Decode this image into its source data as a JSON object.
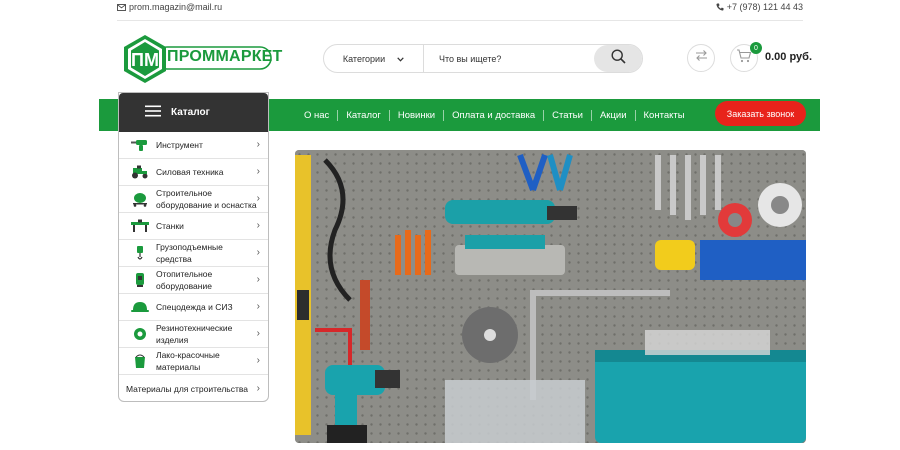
{
  "topbar": {
    "email": "prom.magazin@mail.ru",
    "phone": "+7 (978) 121 44 43"
  },
  "logo": {
    "mark": "ПМ",
    "text": "ПРОММАРКЕТ"
  },
  "search": {
    "category_label": "Категории",
    "placeholder": "Что вы ищете?"
  },
  "cart": {
    "count": "0",
    "total": "0.00 руб."
  },
  "nav": {
    "items": [
      "О нас",
      "Каталог",
      "Новинки",
      "Оплата и доставка",
      "Статьи",
      "Акции",
      "Контакты"
    ],
    "callback_label": "Заказать звонок"
  },
  "catalog": {
    "title": "Каталог",
    "items": [
      {
        "label": "Инструмент",
        "icon": "drill-icon"
      },
      {
        "label": "Силовая техника",
        "icon": "tractor-icon"
      },
      {
        "label": "Строительное оборудование и оснастка",
        "icon": "concrete-mixer-icon"
      },
      {
        "label": "Станки",
        "icon": "machine-tool-icon"
      },
      {
        "label": "Грузоподъемные средства",
        "icon": "hoist-icon"
      },
      {
        "label": "Отопительное оборудование",
        "icon": "heater-icon"
      },
      {
        "label": "Спецодежда и СИЗ",
        "icon": "helmet-icon"
      },
      {
        "label": "Резинотехнические изделия",
        "icon": "rubber-icon"
      },
      {
        "label": "Лако-красочные материалы",
        "icon": "paint-bucket-icon"
      },
      {
        "label": "Материалы для строительства",
        "icon": ""
      }
    ]
  },
  "colors": {
    "brand_green": "#1b9a3d",
    "callback_red": "#e8231b",
    "catalog_header": "#333333"
  }
}
